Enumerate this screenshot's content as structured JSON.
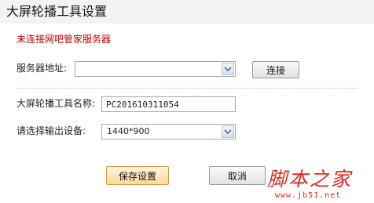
{
  "window": {
    "title": "大屏轮播工具设置"
  },
  "status_text": "未连接网吧管家服务器",
  "server": {
    "label": "服务器地址:",
    "value": "",
    "connect_label": "连接"
  },
  "tool_name": {
    "label": "大屏轮播工具名称:",
    "value": "PC201610311054"
  },
  "output": {
    "label": "请选择输出设备:",
    "value": "1440*900"
  },
  "buttons": {
    "save_label": "保存设置",
    "cancel_label": "取消"
  },
  "watermark": {
    "brand": "脚本之家",
    "url": "www.jb51.net"
  },
  "colors": {
    "status": "#c00000",
    "watermark": "#e0281e",
    "primary_button": "#fbd99a"
  },
  "icons": {
    "dropdown": "chevron-down-icon"
  }
}
